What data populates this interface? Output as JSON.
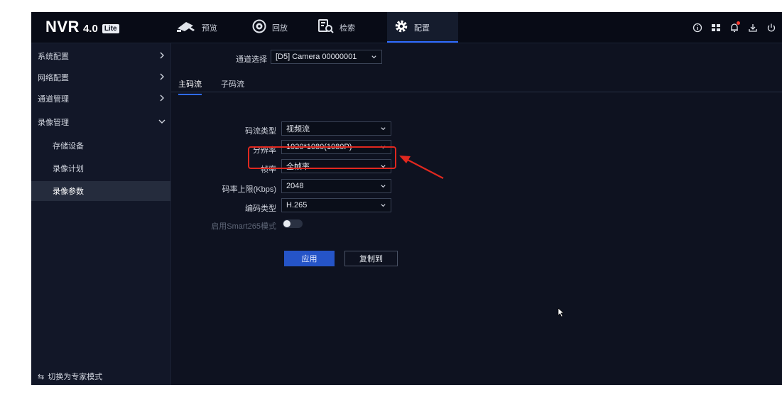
{
  "app": {
    "logo": "NVR",
    "version": "4.0",
    "edition": "Lite"
  },
  "nav": {
    "tabs": [
      {
        "label": "预览",
        "icon": "camera-icon"
      },
      {
        "label": "回放",
        "icon": "playback-icon"
      },
      {
        "label": "检索",
        "icon": "search-file-icon"
      },
      {
        "label": "配置",
        "icon": "gear-icon"
      }
    ],
    "active": "配置"
  },
  "toolbar": {
    "icons": [
      "info-icon",
      "layout-icon",
      "bell-icon",
      "download-icon",
      "power-icon"
    ],
    "alert_color": "#ff3b30"
  },
  "sidebar": {
    "items": [
      {
        "label": "系统配置"
      },
      {
        "label": "网络配置"
      },
      {
        "label": "通道管理"
      },
      {
        "label": "录像管理"
      },
      {
        "label": "存储设备"
      },
      {
        "label": "录像计划"
      },
      {
        "label": "录像参数"
      }
    ],
    "active": "录像参数",
    "expert_mode": "切换为专家模式"
  },
  "channel": {
    "label": "通道选择",
    "value": "[D5] Camera 00000001"
  },
  "stream_tabs": {
    "main": "主码流",
    "sub": "子码流"
  },
  "form": {
    "stream_type": {
      "label": "码流类型",
      "value": "视频流"
    },
    "resolution": {
      "label": "分辨率",
      "value": "1920*1080(1080P)"
    },
    "frame_rate": {
      "label": "帧率",
      "value": "全帧率"
    },
    "bitrate_limit": {
      "label": "码率上限(Kbps)",
      "value": "2048"
    },
    "encoding": {
      "label": "编码类型",
      "value": "H.265"
    },
    "smart265": {
      "label": "启用Smart265模式",
      "enabled": false
    }
  },
  "buttons": {
    "apply": "应用",
    "copy_to": "复制到"
  },
  "colors": {
    "accent": "#2f6bff",
    "annotation": "#e0281f",
    "background": "#0e1220"
  }
}
